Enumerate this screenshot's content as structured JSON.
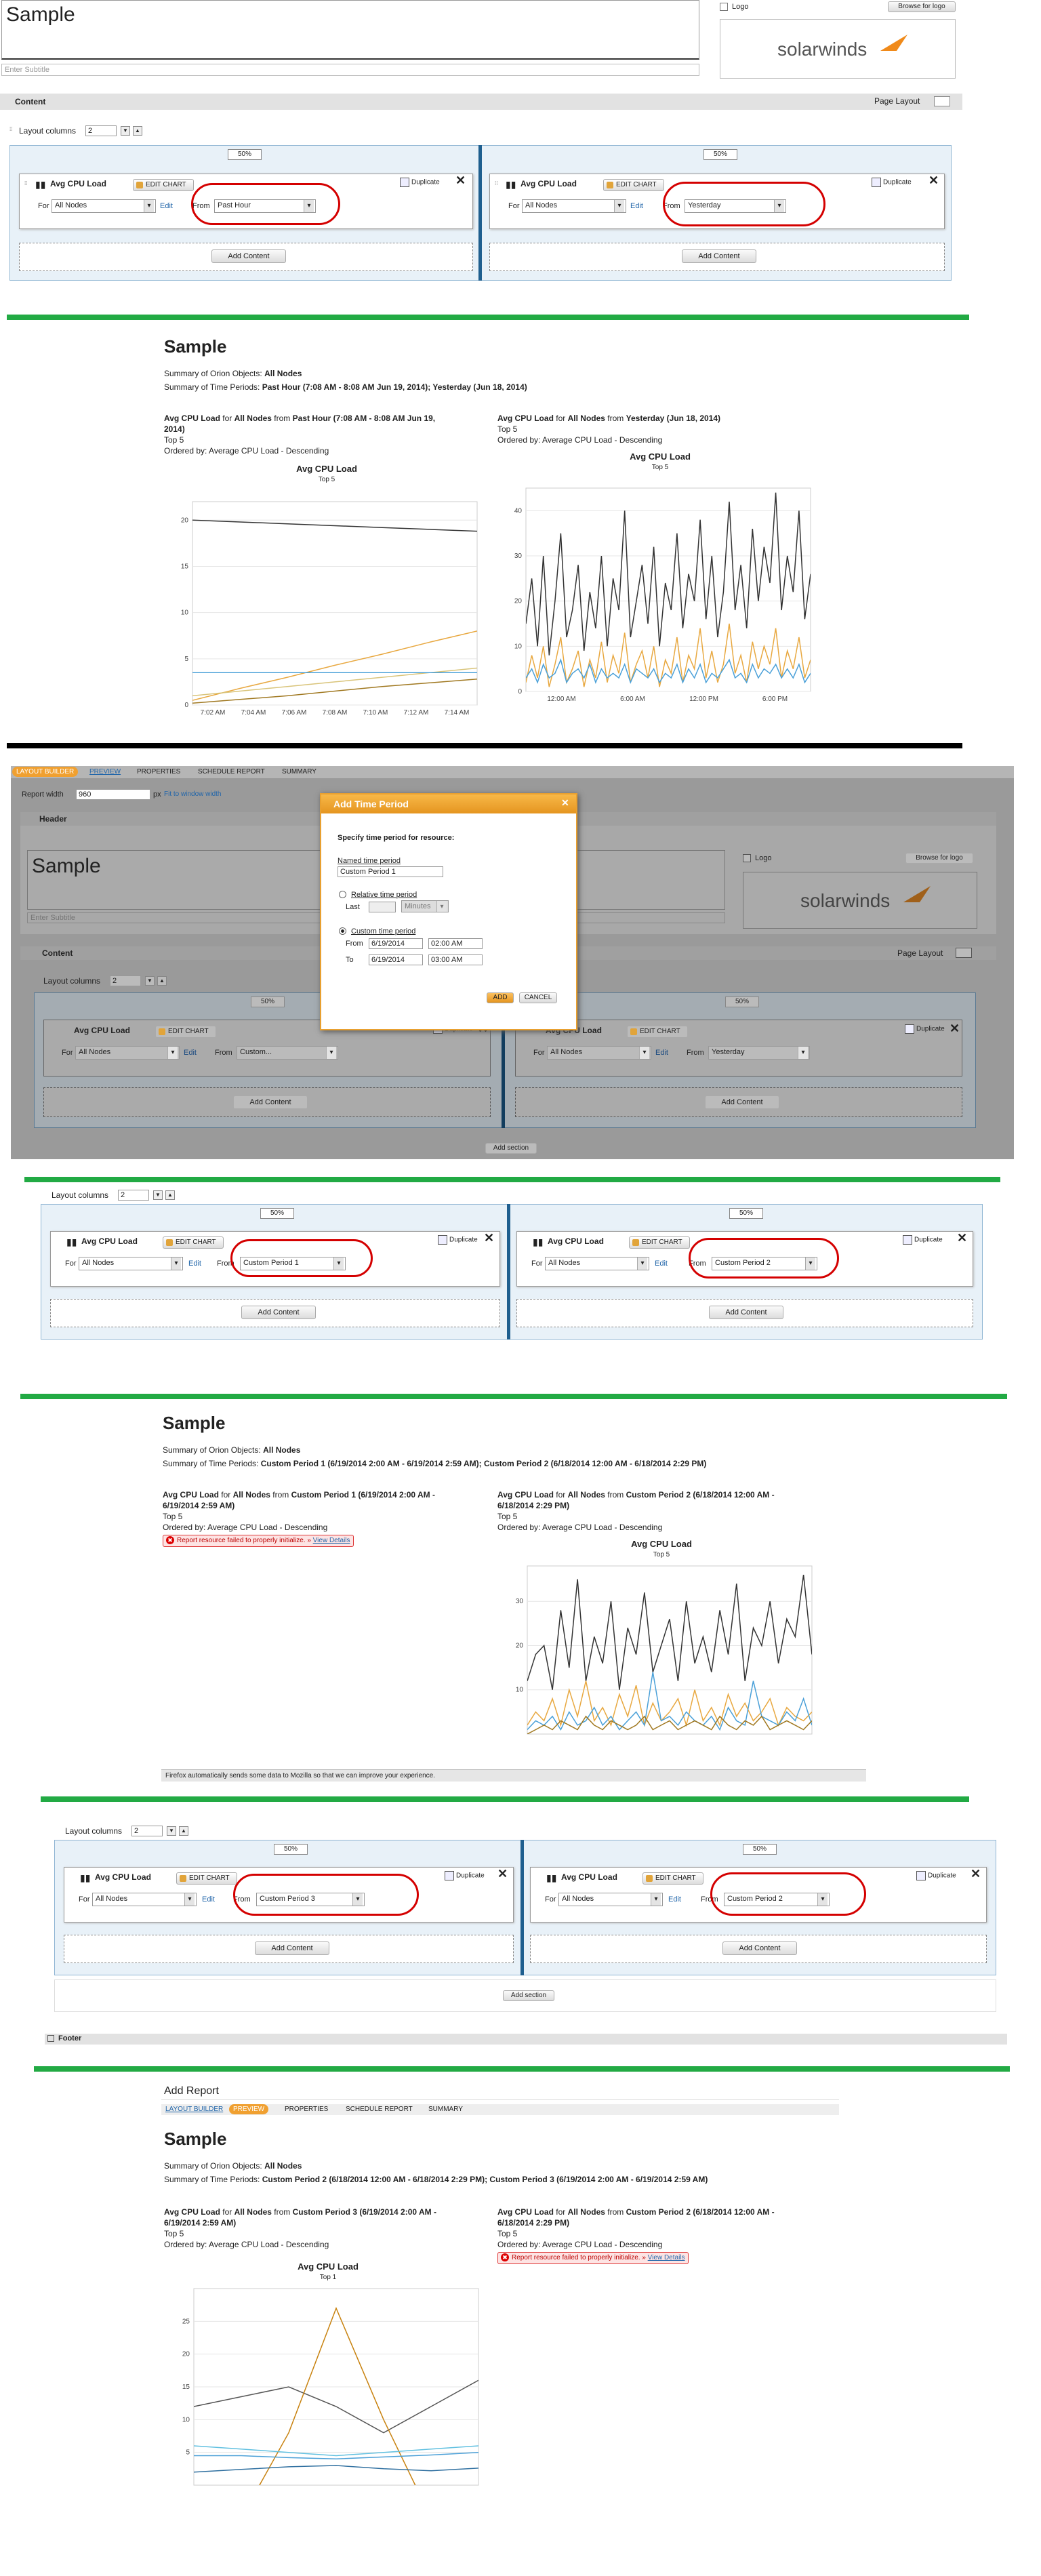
{
  "section1": {
    "title_value": "Sample",
    "subtitle_placeholder": "Enter Subtitle",
    "logo_label": "Logo",
    "browse_logo": "Browse for logo",
    "logo_brand": "solarwinds",
    "content_label": "Content",
    "page_layout": "Page Layout",
    "layout_columns": "Layout columns",
    "columns_value": "2",
    "col_pct": "50%",
    "res_title": "Avg CPU Load",
    "edit_chart": "EDIT CHART",
    "duplicate": "Duplicate",
    "for_label": "For",
    "for_value": "All Nodes",
    "edit_link": "Edit",
    "from_label": "From",
    "left_from": "Past Hour",
    "right_from": "Yesterday",
    "add_content": "Add Content"
  },
  "preview1": {
    "title": "Sample",
    "summary_objects_label": "Summary of Orion Objects:",
    "summary_objects_value": "All Nodes",
    "summary_periods_label": "Summary of Time Periods:",
    "summary_periods_value": "Past Hour (7:08 AM - 8:08 AM Jun 19, 2014); Yesterday (Jun 18, 2014)",
    "left_head_1": "Avg CPU Load",
    "left_head_2": "for",
    "left_head_3": "All Nodes",
    "left_head_4": "from",
    "left_head_5": "Past Hour (7:08 AM - 8:08 AM Jun 19,",
    "left_head_6": "2014)",
    "top5": "Top 5",
    "ordered": "Ordered by: Average CPU Load - Descending",
    "right_head_5": "Yesterday (Jun 18, 2014)",
    "chart_title": "Avg CPU Load",
    "chart_sub": "Top 5"
  },
  "dialog_section": {
    "tabs": [
      "LAYOUT BUILDER",
      "PREVIEW",
      "PROPERTIES",
      "SCHEDULE REPORT",
      "SUMMARY"
    ],
    "report_width_label": "Report width",
    "report_width_value": "960",
    "report_width_unit": "px",
    "fit_window": "Fit to window width",
    "header_label": "Header",
    "left_from": "Custom...",
    "right_from": "Yesterday",
    "add_section": "Add section",
    "dialog": {
      "title": "Add Time Period",
      "heading": "Specify time period for resource:",
      "named_label": "Named time period",
      "named_value": "Custom Period 1",
      "relative_label": "Relative time period",
      "last_label": "Last",
      "minutes": "Minutes",
      "custom_label": "Custom time period",
      "from_label": "From",
      "from_date": "6/19/2014",
      "from_time": "02:00 AM",
      "to_label": "To",
      "to_date": "6/19/2014",
      "to_time": "03:00 AM",
      "add": "ADD",
      "cancel": "CANCEL"
    }
  },
  "section3": {
    "left_from": "Custom Period 1",
    "right_from": "Custom Period 2"
  },
  "preview2": {
    "summary_periods_value": "Custom Period 1 (6/19/2014 2:00 AM - 6/19/2014 2:59 AM); Custom Period 2 (6/18/2014 12:00 AM - 6/18/2014 2:29 PM)",
    "left_head_5": "Custom Period 1 (6/19/2014 2:00 AM -",
    "left_head_6": "6/19/2014 2:59 AM)",
    "right_head_5": "Custom Period 2 (6/18/2014 12:00 AM -",
    "right_head_6": "6/18/2014 2:29 PM)",
    "error": "Report resource failed to properly initialize. »",
    "view_details": "View Details",
    "firefox_bar": "Firefox automatically sends some data to Mozilla so that we can improve your experience.",
    "chart_sub": "Top 5"
  },
  "section5": {
    "left_from": "Custom Period 3",
    "right_from": "Custom Period 2",
    "add_section": "Add section",
    "footer": "Footer"
  },
  "preview3": {
    "window_title": "Add Report",
    "summary_periods_value": "Custom Period 2 (6/18/2014 12:00 AM - 6/18/2014 2:29 PM); Custom Period 3 (6/19/2014 2:00 AM - 6/19/2014 2:59 AM)",
    "left_head_5": "Custom Period 3 (6/19/2014 2:00 AM -",
    "left_head_6": "6/19/2014 2:59 AM)",
    "right_head_5": "Custom Period 2 (6/18/2014 12:00 AM -",
    "right_head_6": "6/18/2014 2:29 PM)",
    "chart_sub": "Top 1"
  },
  "chart_data": [
    {
      "type": "line",
      "title": "Avg CPU Load",
      "subtitle": "Top 5",
      "x": [
        "7:02 AM",
        "7:04 AM",
        "7:06 AM",
        "7:08 AM",
        "7:10 AM",
        "7:12 AM",
        "7:14 AM"
      ],
      "ylim": [
        0,
        22
      ],
      "yticks": [
        0,
        5,
        10,
        15,
        20
      ],
      "series": [
        {
          "values": [
            20,
            19.8,
            19.6,
            19.4,
            19.2,
            19,
            18.8
          ],
          "color": "#333333"
        },
        {
          "values": [
            0.5,
            1.8,
            3,
            4.3,
            5.5,
            6.8,
            8
          ],
          "color": "#e8a840"
        },
        {
          "values": [
            1,
            1.5,
            2,
            2.5,
            3,
            3.5,
            4
          ],
          "color": "#d9c47a"
        },
        {
          "values": [
            3.5,
            3.5,
            3.5,
            3.5,
            3.5,
            3.5,
            3.5
          ],
          "color": "#4aa0d8"
        },
        {
          "values": [
            0.2,
            0.6,
            1,
            1.5,
            2,
            2.4,
            2.8
          ],
          "color": "#a07820"
        }
      ]
    },
    {
      "type": "line",
      "title": "Avg CPU Load",
      "subtitle": "Top 5",
      "x": [
        "12:00 AM",
        "6:00 AM",
        "12:00 PM",
        "6:00 PM"
      ],
      "ylim": [
        0,
        45
      ],
      "yticks": [
        0,
        10,
        20,
        30,
        40
      ],
      "series": [
        {
          "values": [
            15,
            25,
            10,
            30,
            8,
            20,
            35,
            12,
            18,
            28,
            9,
            22,
            14,
            30,
            10,
            25,
            18,
            40,
            12,
            20,
            28,
            15,
            32,
            10,
            24,
            18,
            35,
            14,
            26,
            20,
            38,
            16,
            30,
            12,
            22,
            42,
            18,
            28,
            14,
            36,
            20,
            32,
            24,
            44,
            18,
            30,
            22,
            40,
            16,
            26
          ],
          "color": "#333333"
        },
        {
          "values": [
            2,
            8,
            3,
            10,
            1,
            6,
            12,
            2,
            5,
            9,
            1,
            7,
            3,
            11,
            2,
            8,
            4,
            13,
            2,
            6,
            9,
            3,
            10,
            1,
            7,
            4,
            12,
            2,
            8,
            5,
            14,
            3,
            9,
            2,
            6,
            15,
            4,
            8,
            2,
            11,
            5,
            10,
            6,
            14,
            3,
            9,
            5,
            12,
            3,
            7
          ],
          "color": "#e8a840"
        },
        {
          "values": [
            3,
            5,
            2,
            6,
            3,
            4,
            7,
            2,
            4,
            5,
            3,
            6,
            2,
            5,
            3,
            4,
            3,
            6,
            2,
            5,
            4,
            3,
            5,
            2,
            4,
            3,
            6,
            2,
            5,
            3,
            6,
            2,
            4,
            3,
            5,
            7,
            3,
            4,
            2,
            6,
            3,
            5,
            4,
            6,
            3,
            5,
            3,
            6,
            2,
            4
          ],
          "color": "#4aa0d8"
        }
      ]
    },
    {
      "type": "line",
      "title": "Avg CPU Load",
      "subtitle": "Top 5",
      "ylim": [
        0,
        38
      ],
      "yticks": [
        10,
        20,
        30
      ],
      "series": [
        {
          "values": [
            12,
            18,
            20,
            10,
            28,
            15,
            35,
            12,
            22,
            16,
            30,
            10,
            24,
            18,
            32,
            14,
            20,
            26,
            12,
            30,
            16,
            22,
            14,
            28,
            18,
            34,
            12,
            24,
            20,
            30,
            16,
            26,
            22,
            36,
            18
          ],
          "color": "#333333"
        },
        {
          "values": [
            2,
            5,
            3,
            8,
            2,
            10,
            4,
            12,
            3,
            6,
            2,
            9,
            4,
            11,
            2,
            7,
            3,
            5,
            8,
            2,
            10,
            3,
            6,
            2,
            9,
            4,
            7,
            3,
            5,
            8,
            2,
            6,
            4,
            3,
            5
          ],
          "color": "#e8a840"
        },
        {
          "values": [
            1,
            3,
            2,
            4,
            1,
            5,
            2,
            3,
            6,
            2,
            4,
            1,
            3,
            5,
            2,
            14,
            3,
            4,
            2,
            5,
            3,
            2,
            4,
            1,
            6,
            3,
            2,
            12,
            4,
            3,
            2,
            5,
            3,
            8,
            2
          ],
          "color": "#4aa0d8"
        },
        {
          "values": [
            0,
            1,
            2,
            1,
            3,
            2,
            1,
            4,
            2,
            1,
            3,
            2,
            1,
            2,
            4,
            1,
            2,
            3,
            1,
            2,
            3,
            2,
            1,
            4,
            2,
            1,
            3,
            2,
            4,
            1,
            2,
            3,
            2,
            1,
            3
          ],
          "color": "#a07820"
        }
      ]
    },
    {
      "type": "line",
      "title": "Avg CPU Load",
      "subtitle": "Top 1",
      "ylim": [
        0,
        30
      ],
      "yticks": [
        5,
        10,
        15,
        20,
        25
      ],
      "series": [
        {
          "values": [
            12,
            13.5,
            15,
            12,
            8,
            12,
            16
          ],
          "color": "#555555"
        },
        {
          "values": [
            -5,
            -5,
            8,
            27,
            10,
            -5,
            -5
          ],
          "color": "#c8820f"
        },
        {
          "values": [
            6,
            5.5,
            5,
            4.5,
            5,
            5.5,
            6
          ],
          "color": "#60c0e0"
        },
        {
          "values": [
            4.5,
            4.5,
            4.2,
            4,
            4.3,
            4.6,
            5
          ],
          "color": "#4aa0d8"
        },
        {
          "values": [
            2,
            2.4,
            2.8,
            3,
            2.5,
            2.2,
            2.6
          ],
          "color": "#3070a0"
        }
      ]
    }
  ]
}
